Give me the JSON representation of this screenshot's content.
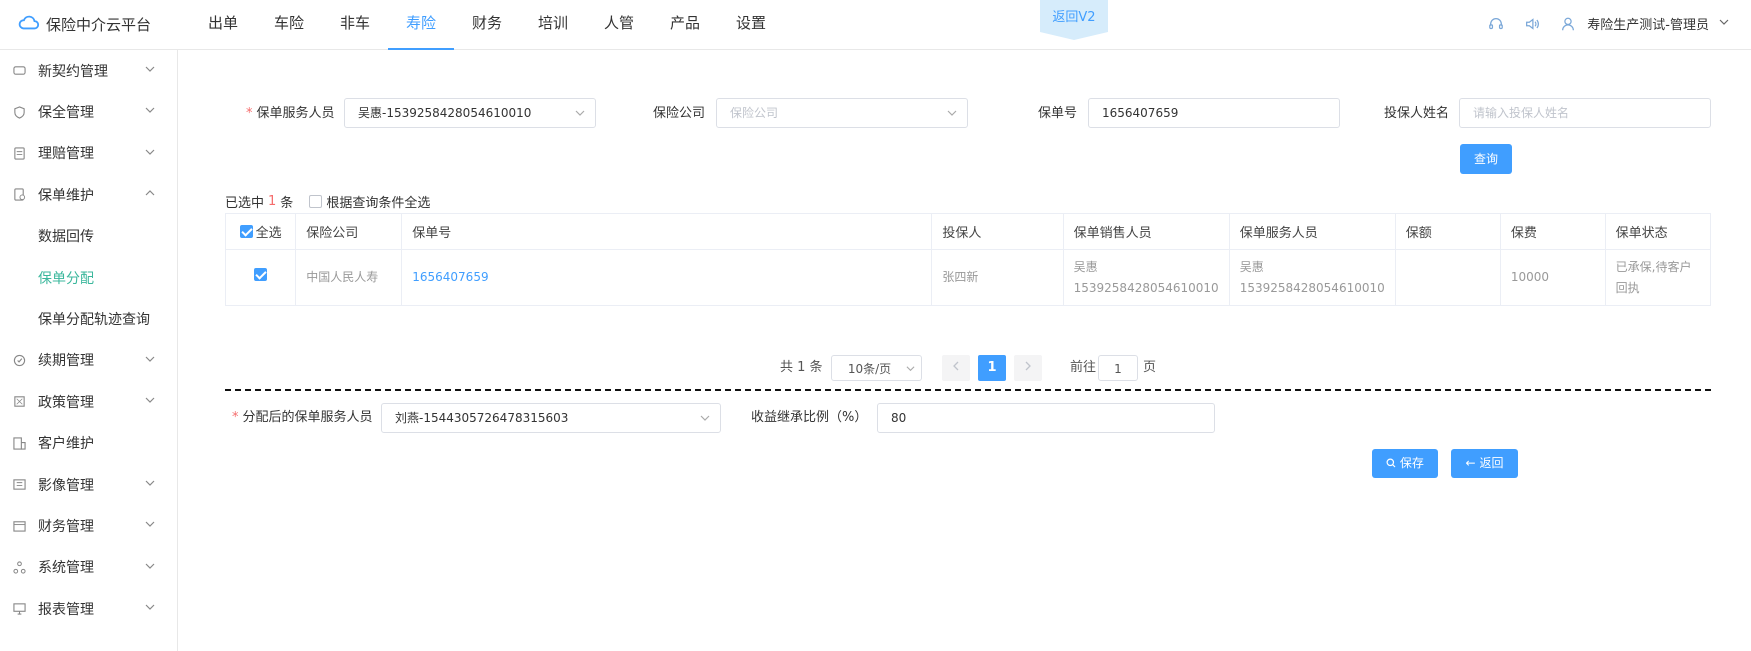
{
  "app": {
    "title": "保险中介云平台"
  },
  "topnav": [
    "出单",
    "车险",
    "非车",
    "寿险",
    "财务",
    "培训",
    "人管",
    "产品",
    "设置"
  ],
  "topnav_active": 3,
  "back_v2": "返回V2",
  "user": {
    "name": "寿险生产测试-管理员"
  },
  "sidebar": {
    "items": [
      {
        "label": "新契约管理",
        "icon": "contract-icon"
      },
      {
        "label": "保全管理",
        "icon": "shield-icon"
      },
      {
        "label": "理赔管理",
        "icon": "claim-doc-icon"
      },
      {
        "label": "保单维护",
        "icon": "policy-doc-icon"
      },
      {
        "label": "数据回传"
      },
      {
        "label": "保单分配"
      },
      {
        "label": "保单分配轨迹查询"
      },
      {
        "label": "续期管理",
        "icon": "renew-icon"
      },
      {
        "label": "政策管理",
        "icon": "policy-icon"
      },
      {
        "label": "客户维护",
        "icon": "customer-icon"
      },
      {
        "label": "影像管理",
        "icon": "image-icon"
      },
      {
        "label": "财务管理",
        "icon": "finance-icon"
      },
      {
        "label": "系统管理",
        "icon": "system-icon"
      },
      {
        "label": "报表管理",
        "icon": "report-icon"
      }
    ]
  },
  "search": {
    "service_label": "保单服务人员",
    "service_value": "吴惠-1539258428054610010",
    "company_label": "保险公司",
    "company_placeholder": "保险公司",
    "policy_label": "保单号",
    "policy_value": "1656407659",
    "holder_label": "投保人姓名",
    "holder_placeholder": "请输入投保人姓名",
    "query_button": "查询"
  },
  "selection": {
    "prefix": "已选中",
    "count": "1",
    "suffix": "条",
    "select_all_by_query": "根据查询条件全选"
  },
  "table": {
    "select_all": "全选",
    "headers": [
      "保险公司",
      "保单号",
      "投保人",
      "保单销售人员",
      "保单服务人员",
      "保额",
      "保费",
      "保单状态"
    ],
    "rows": [
      {
        "company": "中国人民人寿",
        "policy_no": "1656407659",
        "holder": "张四新",
        "sales_name": "吴惠",
        "sales_id": "1539258428054610010",
        "service_name": "吴惠",
        "service_id": "1539258428054610010",
        "amount": "",
        "premium": "10000",
        "status": "已承保,待客户回执",
        "checked": true
      }
    ]
  },
  "pager": {
    "total": "共 1 条",
    "page_size": "10条/页",
    "current": "1",
    "goto_prefix": "前往",
    "goto_value": "1",
    "goto_suffix": "页"
  },
  "assign": {
    "service_label": "分配后的保单服务人员",
    "service_value": "刘燕-1544305726478315603",
    "ratio_label": "收益继承比例（%）",
    "ratio_value": "80",
    "save_button": "保存",
    "back_button": "返回"
  },
  "colors": {
    "primary": "#409eff",
    "active_sub": "#3bb79c",
    "required": "#f56c6c"
  }
}
